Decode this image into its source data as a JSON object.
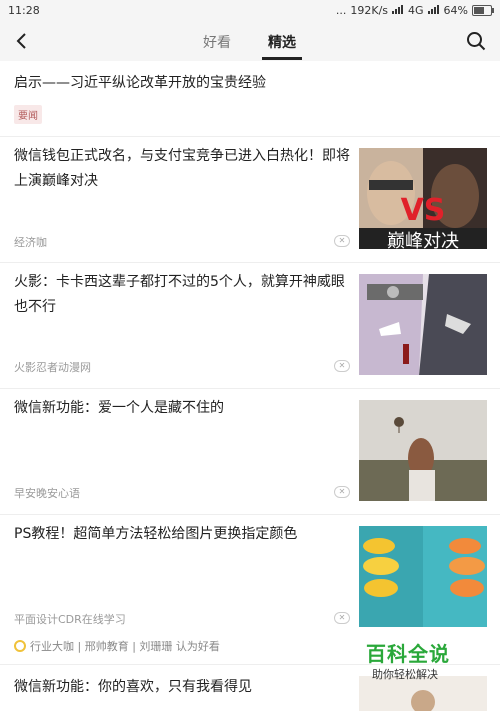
{
  "status_bar": {
    "time": "11:28",
    "dots": "...",
    "network_speed": "192K/s",
    "network_type": "4G",
    "battery": "64%",
    "battery_level": 0.64
  },
  "nav": {
    "tabs": [
      {
        "label": "好看"
      },
      {
        "label": "精选"
      }
    ],
    "active_tab": "精选"
  },
  "articles": [
    {
      "title": "启示——习近平纵论改革开放的宝贵经验",
      "tag": "要闻"
    },
    {
      "title": "微信钱包正式改名，与支付宝竞争已进入白热化！即将上演巅峰对决",
      "source": "经济咖"
    },
    {
      "title": "火影：卡卡西这辈子都打不过的5个人，就算开神威眼也不行",
      "source": "火影忍者动漫网"
    },
    {
      "title": "微信新功能：爱一个人是藏不住的",
      "source": "早安晚安心语"
    },
    {
      "title": "PS教程！超简单方法轻松给图片更换指定颜色",
      "source": "平面设计CDR在线学习"
    },
    {
      "title": "微信新功能：你的喜欢，只有我看得见"
    }
  ],
  "thumb_text": {
    "vs": "VS",
    "vs_caption": "巅峰对决"
  },
  "recommend": {
    "names": "行业大咖 | 邢帅教育 | 刘珊珊 认为好看"
  },
  "watermark": {
    "title": "百科全说",
    "subtitle": "助你轻松解决"
  },
  "icons": [
    "back-arrow-icon",
    "search-icon",
    "close-icon",
    "sun-icon"
  ]
}
